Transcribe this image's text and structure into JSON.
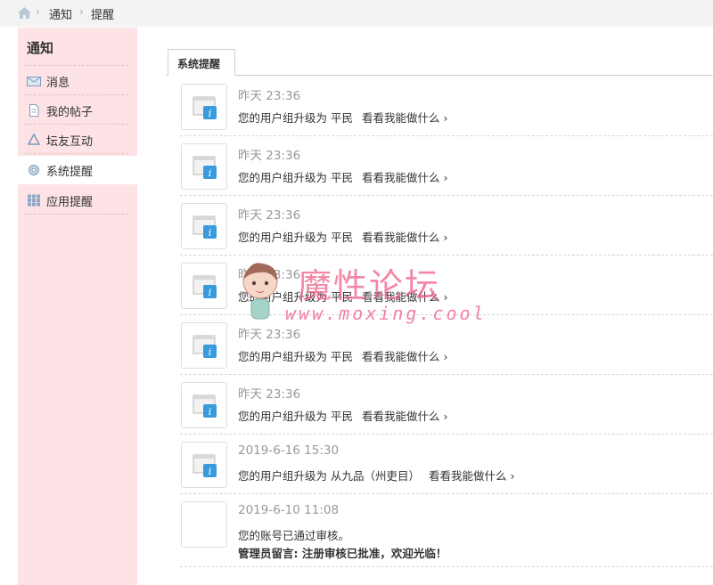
{
  "breadcrumb": {
    "home_icon": "home-icon",
    "items": [
      "通知",
      "提醒"
    ]
  },
  "sidebar": {
    "title": "通知",
    "items": [
      {
        "label": "消息",
        "icon": "envelope-icon"
      },
      {
        "label": "我的帖子",
        "icon": "document-icon"
      },
      {
        "label": "坛友互动",
        "icon": "recycle-icon"
      },
      {
        "label": "系统提醒",
        "icon": "gear-icon",
        "active": true
      },
      {
        "label": "应用提醒",
        "icon": "grid-icon"
      }
    ]
  },
  "tab": {
    "label": "系统提醒"
  },
  "notices": [
    {
      "time": "昨天 23:36",
      "text": "您的用户组升级为 平民",
      "link": "看看我能做什么 ›"
    },
    {
      "time": "昨天 23:36",
      "text": "您的用户组升级为 平民",
      "link": "看看我能做什么 ›"
    },
    {
      "time": "昨天 23:36",
      "text": "您的用户组升级为 平民",
      "link": "看看我能做什么 ›"
    },
    {
      "time": "昨天 23:36",
      "text": "您的用户组升级为 平民",
      "link": "看看我能做什么 ›"
    },
    {
      "time": "昨天 23:36",
      "text": "您的用户组升级为 平民",
      "link": "看看我能做什么 ›"
    },
    {
      "time": "昨天 23:36",
      "text": "您的用户组升级为 平民",
      "link": "看看我能做什么 ›"
    },
    {
      "time": "2019-6-16 15:30",
      "text": "您的用户组升级为 从九品（州吏目）",
      "link": "看看我能做什么 ›"
    },
    {
      "time": "2019-6-10 11:08",
      "text": "您的账号已通过审核。",
      "text2": "管理员留言: 注册审核已批准，欢迎光临！"
    }
  ],
  "watermark": {
    "title": "魔性论坛",
    "url": "www.moxing.cool"
  }
}
